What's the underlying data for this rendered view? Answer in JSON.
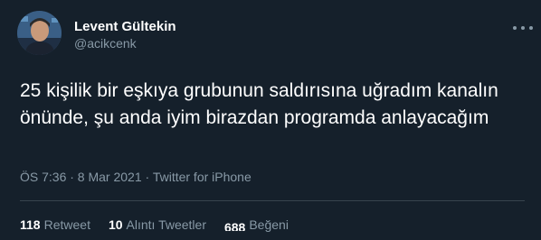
{
  "author": {
    "name": "Levent Gültekin",
    "handle": "@acikcenk"
  },
  "tweet": {
    "text": "25 kişilik bir eşkıya grubunun saldırısına uğradım kanalın önünde, şu anda iyim birazdan programda anlayacağım",
    "meta": "ÖS 7:36 · 8 Mar 2021 · Twitter for iPhone"
  },
  "stats": {
    "retweets_count": "118",
    "retweets_label": "Retweet",
    "quotes_count": "10",
    "quotes_label": "Alıntı Tweetler",
    "likes_count": "688",
    "likes_label": "Beğeni"
  },
  "icons": {
    "more": "more-horizontal-icon"
  },
  "colors": {
    "background": "#15202b",
    "text_primary": "#ffffff",
    "text_secondary": "#8899a6",
    "divider": "#38444d"
  }
}
